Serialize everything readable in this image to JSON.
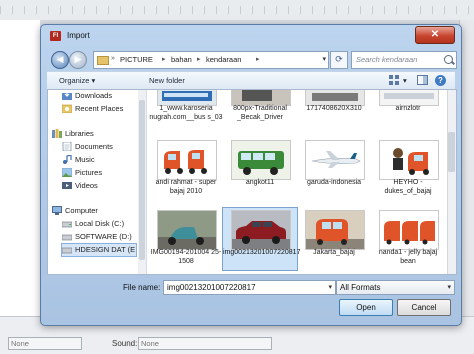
{
  "dialog": {
    "title": "Import",
    "app_icon_text": "Fl",
    "close_glyph": "✕"
  },
  "address": {
    "crumbs": [
      "PICTURE",
      "bahan",
      "kendaraan"
    ],
    "search_placeholder": "Search kendaraan"
  },
  "toolbar": {
    "organize": "Organize ▾",
    "new_folder": "New folder"
  },
  "nav": {
    "items": [
      {
        "label": "Downloads",
        "icon": "downloads-icon"
      },
      {
        "label": "Recent Places",
        "icon": "recent-places-icon"
      },
      {
        "label": "Libraries",
        "icon": "libraries-icon"
      },
      {
        "label": "Documents",
        "icon": "documents-icon"
      },
      {
        "label": "Music",
        "icon": "music-icon"
      },
      {
        "label": "Pictures",
        "icon": "pictures-icon"
      },
      {
        "label": "Videos",
        "icon": "videos-icon"
      },
      {
        "label": "Computer",
        "icon": "computer-icon"
      },
      {
        "label": "Local Disk (C:)",
        "icon": "drive-icon"
      },
      {
        "label": "SOFTWARE (D:)",
        "icon": "drive-icon"
      },
      {
        "label": "HDESIGN DAT (E",
        "icon": "drive-icon"
      }
    ]
  },
  "files": [
    {
      "name": "1_www.karoseria nugrah.com__bus s_03"
    },
    {
      "name": "800px-Traditional _Becak_Driver"
    },
    {
      "name": "1717408620X310"
    },
    {
      "name": "airnzlotr"
    },
    {
      "name": "andi rahmat - super bajaj 2010"
    },
    {
      "name": "angkot11"
    },
    {
      "name": "garuda-indonesia"
    },
    {
      "name": "HEYHO - dukes_of_bajaj"
    },
    {
      "name": "IMG00194-201004 25-1508"
    },
    {
      "name": "img00213201007220817"
    },
    {
      "name": "Jakarta_bajaj"
    },
    {
      "name": "nanda1 - jelly bajaj bean"
    }
  ],
  "bottom": {
    "file_name_label": "File name:",
    "file_name_value": "img00213201007220817",
    "format_value": "All Formats",
    "open_label": "Open",
    "cancel_label": "Cancel"
  },
  "background": {
    "sound_label": "Sound:",
    "sound_value": "None",
    "left_value": "None"
  },
  "colors": {
    "dialog_frame": "#a9c3e2",
    "selection": "#cde3f8",
    "bajaj_orange": "#e0542a"
  }
}
